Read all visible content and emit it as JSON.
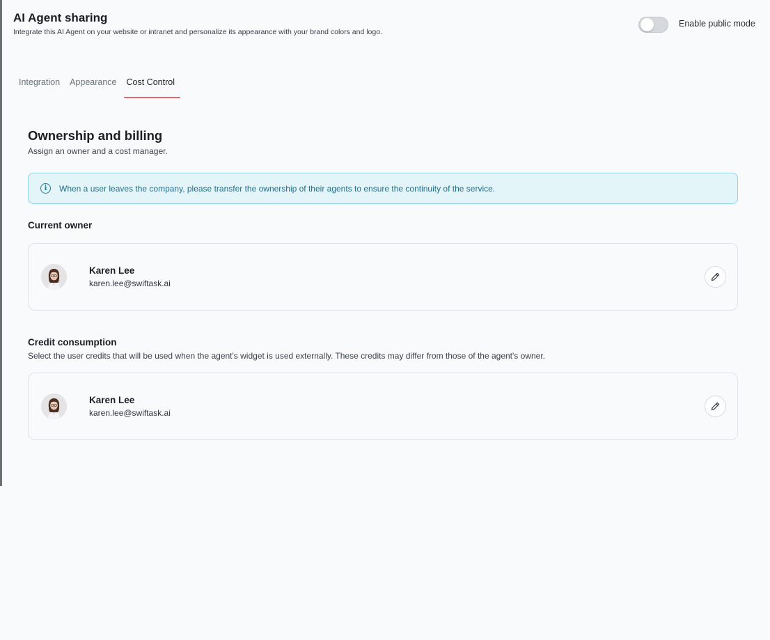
{
  "header": {
    "title": "AI Agent sharing",
    "subtitle": "Integrate this AI Agent on your website or intranet and personalize its appearance with your brand colors and logo.",
    "public_mode_label": "Enable public mode",
    "public_mode_enabled": false
  },
  "tabs": [
    {
      "label": "Integration",
      "active": false
    },
    {
      "label": "Appearance",
      "active": false
    },
    {
      "label": "Cost Control",
      "active": true
    }
  ],
  "section": {
    "title": "Ownership and billing",
    "subtitle": "Assign an owner and a cost manager."
  },
  "info_banner": {
    "icon": "info-icon",
    "text": "When a user leaves the company, please transfer the ownership of their agents to ensure the continuity of the service."
  },
  "current_owner": {
    "heading": "Current owner",
    "user": {
      "name": "Karen Lee",
      "email": "karen.lee@swiftask.ai"
    },
    "edit_icon": "pencil-icon"
  },
  "credit_consumption": {
    "heading": "Credit consumption",
    "description": "Select the user credits that will be used when the agent's widget is used externally. These credits may differ from those of the agent's owner.",
    "user": {
      "name": "Karen Lee",
      "email": "karen.lee@swiftask.ai"
    },
    "edit_icon": "pencil-icon"
  },
  "colors": {
    "accent_tab": "#e26a6f",
    "info_bg": "#e3f5f9",
    "info_border": "#8fd4e2",
    "info_text": "#1f6f8f"
  }
}
